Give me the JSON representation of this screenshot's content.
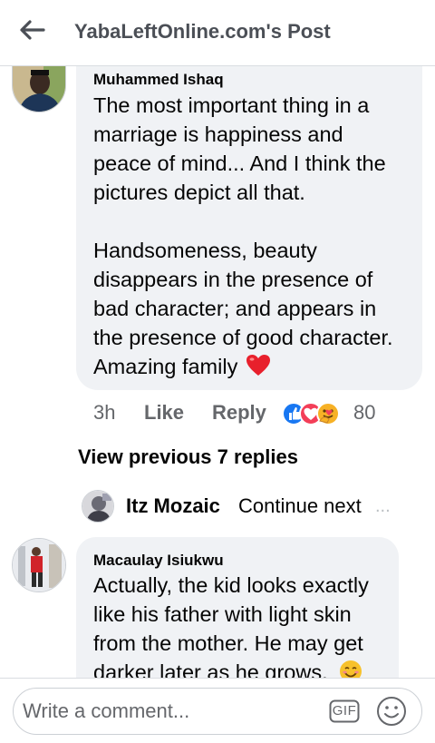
{
  "header": {
    "title": "YabaLeftOnline.com's Post",
    "back_icon": "arrow-left-icon"
  },
  "comment1": {
    "author": "Muhammed Ishaq",
    "lines": [
      "The most important thing in a",
      "marriage is happiness and",
      "peace of mind... And I think the",
      "pictures depict all that.",
      "",
      "Handsomeness, beauty",
      "disappears in the presence of",
      "bad character; and appears in",
      "the presence of good character.",
      "Amazing family"
    ],
    "time": "3h",
    "like_label": "Like",
    "reply_label": "Reply",
    "reaction_count": "80",
    "reaction_icons": [
      "like-reaction-icon",
      "love-reaction-icon",
      "care-reaction-icon"
    ]
  },
  "view_previous": "View previous 7 replies",
  "reply_preview": {
    "author": "Itz Mozaic",
    "text": "Continue next",
    "ellipsis": "..."
  },
  "comment2": {
    "author": "Macaulay Isiukwu",
    "lines": [
      "Actually, the kid looks exactly",
      "like his father with light skin",
      "from the mother. He may get",
      "darker later as he grows."
    ]
  },
  "composer": {
    "placeholder": "Write a comment...",
    "gif_label": "GIF"
  },
  "colors": {
    "bubble": "#f0f2f5",
    "like_blue": "#1877f2",
    "love_red": "#f33e58",
    "care_yellow": "#f7b125",
    "text_secondary": "#65676b"
  }
}
